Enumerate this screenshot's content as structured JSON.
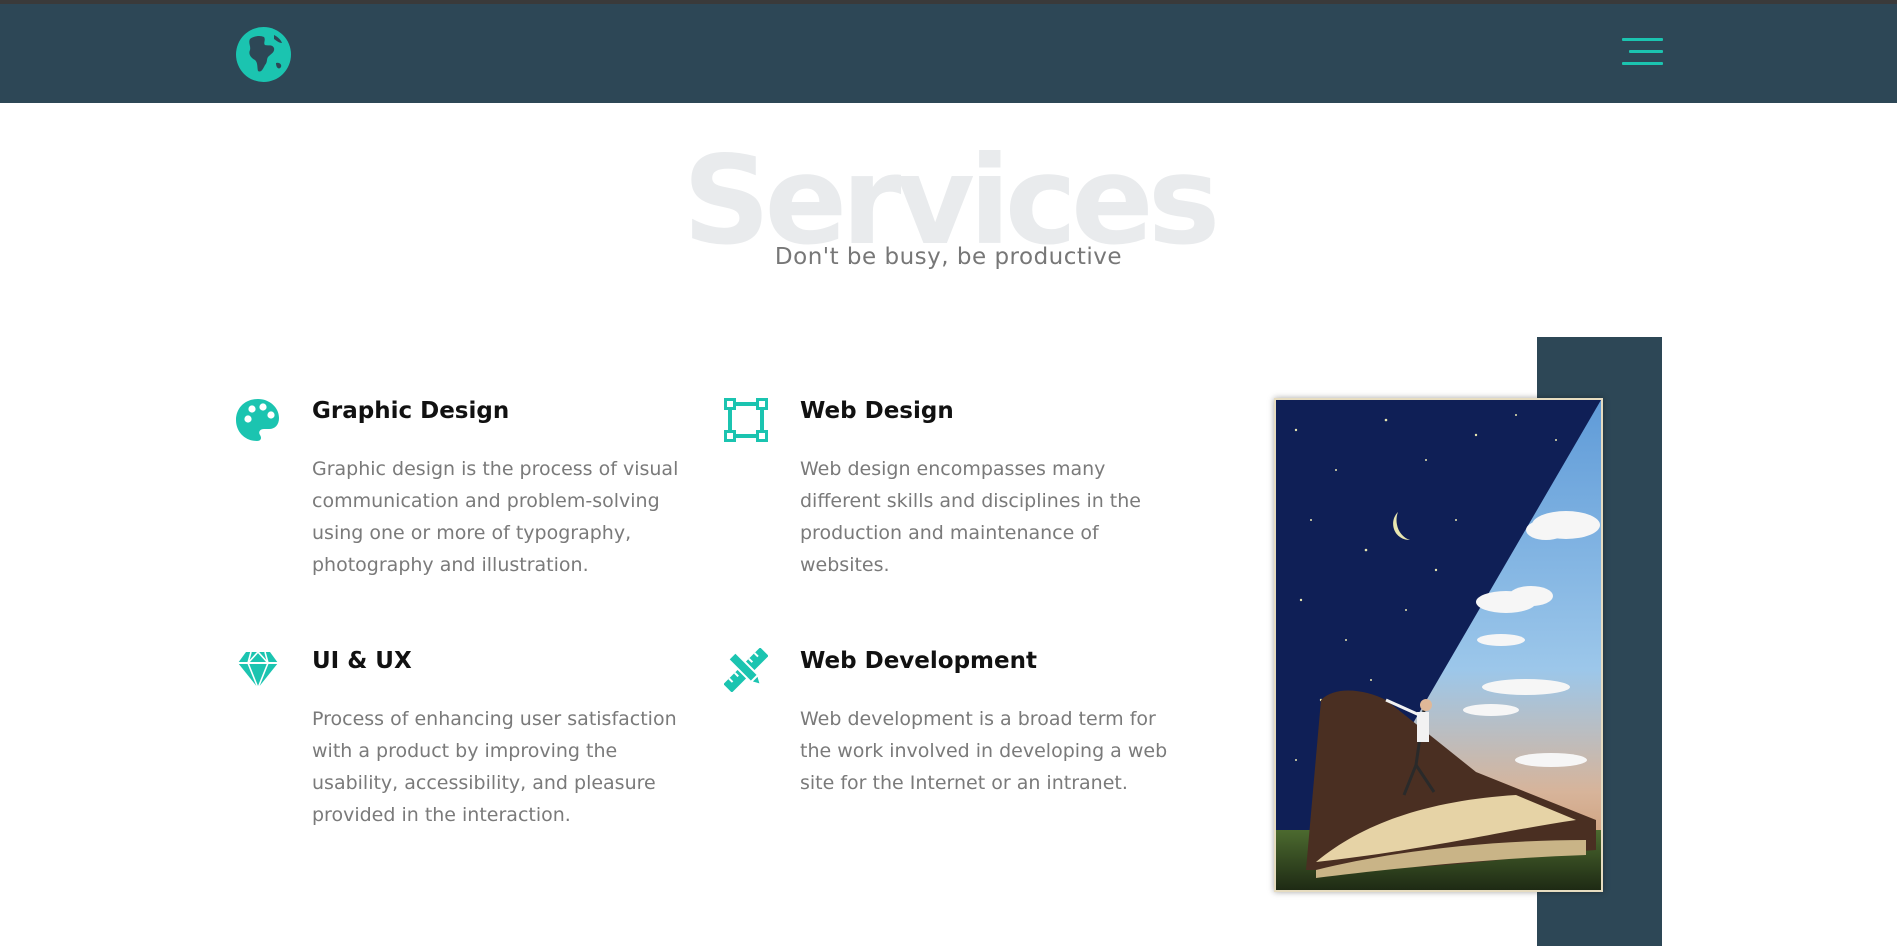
{
  "header": {
    "logo_icon": "globe-icon",
    "menu_icon": "hamburger-menu-icon",
    "accent_color": "#1bc4b0",
    "background_color": "#2d4756"
  },
  "hero": {
    "title": "Services",
    "subtitle": "Don't be busy, be productive"
  },
  "services": [
    {
      "icon": "palette-icon",
      "title": "Graphic Design",
      "description": "Graphic design is the process of visual communication and problem-solving using one or more of typography, photography and illustration."
    },
    {
      "icon": "vector-square-icon",
      "title": "Web Design",
      "description": "Web design encompasses many different skills and disciplines in the production and maintenance of websites."
    },
    {
      "icon": "diamond-icon",
      "title": "UI & UX",
      "description": "Process of enhancing user satisfaction with a product by improving the usability, accessibility, and pleasure provided in the interaction."
    },
    {
      "icon": "pencil-ruler-icon",
      "title": "Web Development",
      "description": "Web development is a broad term for the work involved in developing a web site for the Internet or an intranet."
    }
  ]
}
